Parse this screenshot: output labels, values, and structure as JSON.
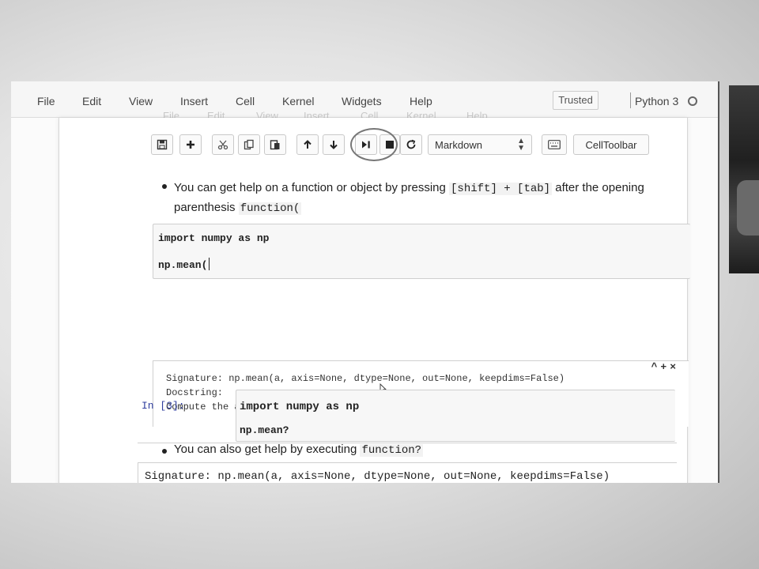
{
  "menu": {
    "items": [
      "File",
      "Edit",
      "View",
      "Insert",
      "Cell",
      "Kernel",
      "Widgets",
      "Help"
    ],
    "trusted": "Trusted",
    "kernel_name": "Python 3"
  },
  "toolbar": {
    "icons": [
      "save-icon",
      "plus-icon",
      "cut-icon",
      "copy-icon",
      "paste-icon",
      "arrow-up-icon",
      "arrow-down-icon",
      "run-icon",
      "stop-icon",
      "restart-icon"
    ],
    "cell_type": "Markdown",
    "keyboard_icon": "keyboard-icon",
    "celltoolbar": "CellToolbar"
  },
  "cells": {
    "bullet1": {
      "text_a": "You can get help on a function or object by pressing ",
      "code_a": "[shift] + [tab]",
      "text_b": " after the opening",
      "text_c": "parenthesis ",
      "code_b": "function("
    },
    "code1": {
      "line1": "import numpy as np",
      "line2": "np.mean("
    },
    "tooltip": {
      "controls": "^+×",
      "signature": "Signature: np.mean(a, axis=None, dtype=None, out=None, keepdims=False)",
      "docstring_label": "Docstring:",
      "docstring": "Compute the arithmetic mean along the specified axis."
    },
    "bullet2": {
      "text": "You can also get help by executing ",
      "code": "function?"
    },
    "code2": {
      "prompt": "In [3]:",
      "line1": "import numpy as np",
      "line2": "np.mean?"
    },
    "output": {
      "signature": "Signature: np.mean(a, axis=None, dtype=None, out=None, keepdims=False)"
    }
  }
}
